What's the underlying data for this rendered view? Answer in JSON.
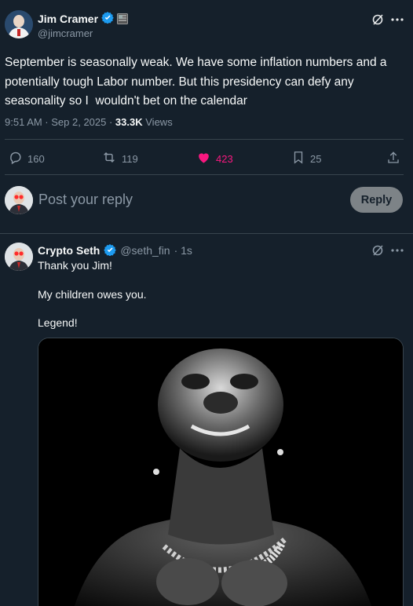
{
  "tweet": {
    "author_name": "Jim Cramer",
    "author_handle": "@jimcramer",
    "text": "September is seasonally weak. We have some inflation numbers and a potentially tough Labor number. But this presidency can defy any seasonality so I  wouldn't bet on the calendar",
    "time": "9:51 AM · Sep 2, 2025 · ",
    "views_count": "33.3K",
    "views_label": "Views",
    "replies": "160",
    "retweets": "119",
    "likes": "423",
    "bookmarks": "25"
  },
  "reply_box": {
    "placeholder": "Post your reply",
    "button_label": "Reply"
  },
  "reply": {
    "author_name": "Crypto Seth",
    "author_handle": "@seth_fin",
    "age": "· 1s",
    "lines": [
      "Thank you Jim!",
      "My children owes you.",
      "Legend!"
    ]
  },
  "colors": {
    "background": "#15202b",
    "text": "#f7f9f9",
    "muted": "#8b98a5",
    "like_pink": "#f91880",
    "verified_blue": "#1d9bf0",
    "divider": "#38444d"
  },
  "icons": [
    "grok-icon",
    "more-icon",
    "reply-icon",
    "retweet-icon",
    "heart-icon",
    "bookmark-icon",
    "share-icon",
    "verified-icon",
    "flag-icon"
  ]
}
